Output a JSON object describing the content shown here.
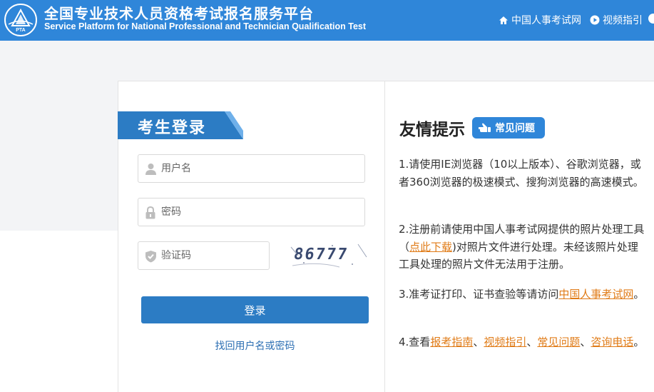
{
  "header": {
    "logo_text": "PTA",
    "title": "全国专业技术人员资格考试报名服务平台",
    "subtitle": "Service Platform for National Professional and Technician Qualification Test",
    "nav": [
      {
        "label": "中国人事考试网",
        "icon": "home-icon"
      },
      {
        "label": "视频指引",
        "icon": "play-circle-icon"
      }
    ]
  },
  "login": {
    "tab_label": "考生登录",
    "username_placeholder": "用户名",
    "password_placeholder": "密码",
    "captcha_placeholder": "验证码",
    "captcha_text": "86777",
    "submit_label": "登录",
    "recover_link": "找回用户名或密码"
  },
  "tips": {
    "title": "友情提示",
    "faq_badge": "常见问题",
    "tip1": "1.请使用IE浏览器（10以上版本）、谷歌浏览器，或者360浏览器的极速模式、搜狗浏览器的高速模式。",
    "tip2": {
      "before": "2.注册前请使用中国人事考试网提供的照片处理工具（",
      "link": "点此下载",
      "after": ")对照片文件进行处理。未经该照片处理工具处理的照片文件无法用于注册。"
    },
    "tip3": {
      "before": "3.准考证打印、证书查验等请访问",
      "link": "中国人事考试网",
      "after": "。"
    },
    "tip4": {
      "before": "4.查看",
      "link1": "报考指南",
      "sep1": "、",
      "link2": "视频指引",
      "sep2": "、",
      "link3": "常见问题",
      "sep3": "、",
      "link4": "咨询电话",
      "after": "。"
    }
  },
  "colors": {
    "header_bg": "#2f86d9",
    "button_bg": "#2c7cc4",
    "link_orange": "#e07b17",
    "tab_blue": "#2c7cc4"
  }
}
